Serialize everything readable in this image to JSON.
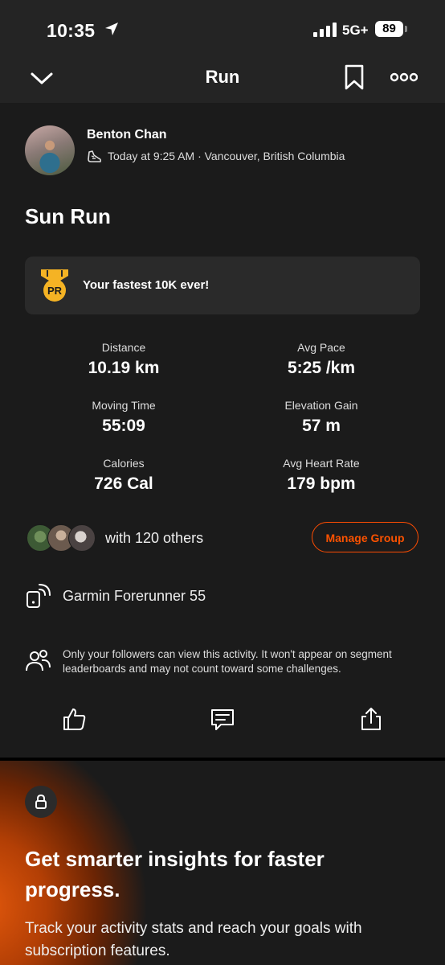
{
  "status_bar": {
    "time": "10:35",
    "network": "5G+",
    "battery": "89"
  },
  "nav": {
    "title": "Run"
  },
  "activity": {
    "athlete_name": "Benton Chan",
    "meta": "Today at 9:25 AM · Vancouver, British Columbia",
    "title": "Sun Run",
    "achievement": {
      "badge": "PR",
      "text": "Your fastest 10K ever!"
    }
  },
  "stats": [
    {
      "label": "Distance",
      "value": "10.19 km"
    },
    {
      "label": "Avg Pace",
      "value": "5:25 /km"
    },
    {
      "label": "Moving Time",
      "value": "55:09"
    },
    {
      "label": "Elevation Gain",
      "value": "57 m"
    },
    {
      "label": "Calories",
      "value": "726 Cal"
    },
    {
      "label": "Avg Heart Rate",
      "value": "179 bpm"
    }
  ],
  "group": {
    "text": "with 120 others",
    "button": "Manage Group"
  },
  "device": {
    "name": "Garmin Forerunner 55"
  },
  "privacy": {
    "text": "Only your followers can view this activity. It won't appear on segment leaderboards and may not count toward some challenges."
  },
  "promo": {
    "title": "Get smarter insights for faster progress.",
    "text": "Track your activity stats and reach your goals with subscription features."
  },
  "colors": {
    "accent": "#fc4c02",
    "background": "#1b1b1b",
    "header": "#242424",
    "badge": "#f5b324"
  },
  "icons": [
    "location-arrow-icon",
    "signal-icon",
    "chevron-down-icon",
    "bookmark-icon",
    "more-icon",
    "shoe-icon",
    "pr-medal-icon",
    "device-sync-icon",
    "followers-icon",
    "like-icon",
    "comment-icon",
    "share-icon",
    "lock-icon"
  ]
}
